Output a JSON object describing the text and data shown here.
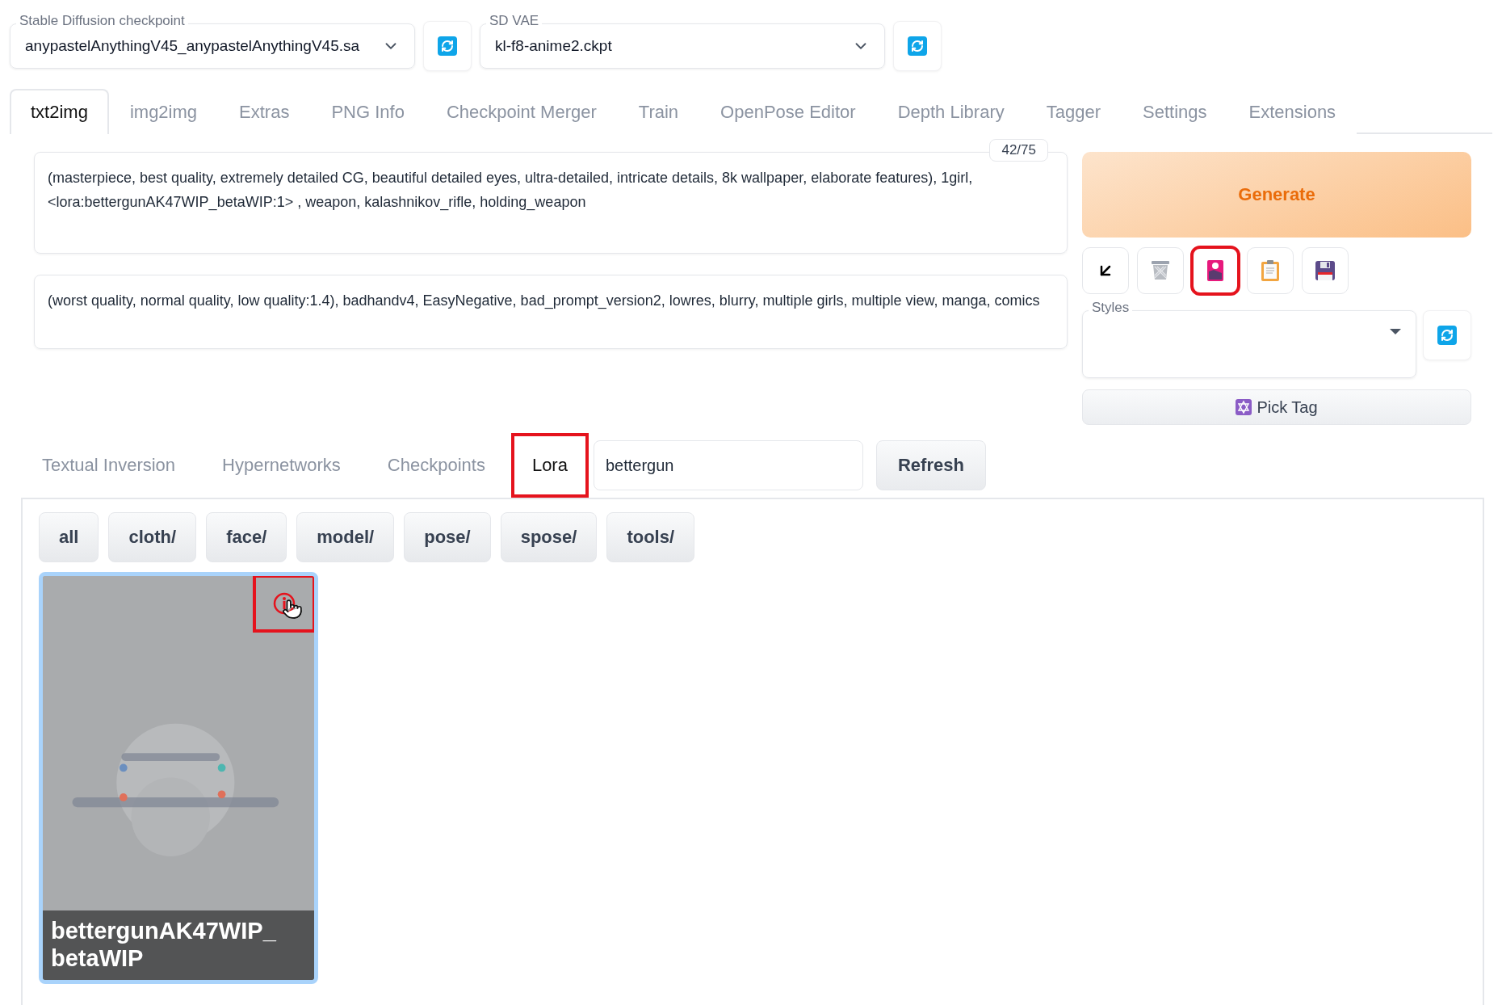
{
  "checkpoint": {
    "label": "Stable Diffusion checkpoint",
    "value": "anypastelAnythingV45_anypastelAnythingV45.sa"
  },
  "vae": {
    "label": "SD VAE",
    "value": "kl-f8-anime2.ckpt"
  },
  "tabs": [
    {
      "label": "txt2img",
      "selected": true
    },
    {
      "label": "img2img",
      "selected": false
    },
    {
      "label": "Extras",
      "selected": false
    },
    {
      "label": "PNG Info",
      "selected": false
    },
    {
      "label": "Checkpoint Merger",
      "selected": false
    },
    {
      "label": "Train",
      "selected": false
    },
    {
      "label": "OpenPose Editor",
      "selected": false
    },
    {
      "label": "Depth Library",
      "selected": false
    },
    {
      "label": "Tagger",
      "selected": false
    },
    {
      "label": "Settings",
      "selected": false
    },
    {
      "label": "Extensions",
      "selected": false
    }
  ],
  "prompt": {
    "text": "(masterpiece, best quality, extremely detailed CG, beautiful detailed eyes, ultra-detailed, intricate details, 8k wallpaper, elaborate features), 1girl, <lora:bettergunAK47WIP_betaWIP:1> , weapon, kalashnikov_rifle, holding_weapon",
    "token_count": "42/75"
  },
  "negative_prompt": {
    "text": "(worst quality, normal quality, low quality:1.4), badhandv4, EasyNegative, bad_prompt_version2, lowres, blurry, multiple girls, multiple view, manga, comics"
  },
  "generate": {
    "label": "Generate"
  },
  "tool_buttons": [
    {
      "kind": "arrow",
      "highlighted": false
    },
    {
      "kind": "trash",
      "highlighted": false
    },
    {
      "kind": "picture",
      "highlighted": true
    },
    {
      "kind": "clipboard",
      "highlighted": false
    },
    {
      "kind": "save",
      "highlighted": false
    }
  ],
  "styles": {
    "label": "Styles"
  },
  "pick_tag": {
    "label": "Pick Tag"
  },
  "network_tabs": [
    {
      "label": "Textual Inversion",
      "selected": false,
      "highlighted": false
    },
    {
      "label": "Hypernetworks",
      "selected": false,
      "highlighted": false
    },
    {
      "label": "Checkpoints",
      "selected": false,
      "highlighted": false
    },
    {
      "label": "Lora",
      "selected": true,
      "highlighted": true
    }
  ],
  "search": {
    "value": "bettergun"
  },
  "refresh": {
    "label": "Refresh"
  },
  "folders": [
    "all",
    "cloth/",
    "face/",
    "model/",
    "pose/",
    "spose/",
    "tools/"
  ],
  "cards": [
    {
      "kind": "picture",
      "title": "bettergunAK47WIP_betaWIP",
      "selected": true,
      "info_highlighted": true
    }
  ]
}
